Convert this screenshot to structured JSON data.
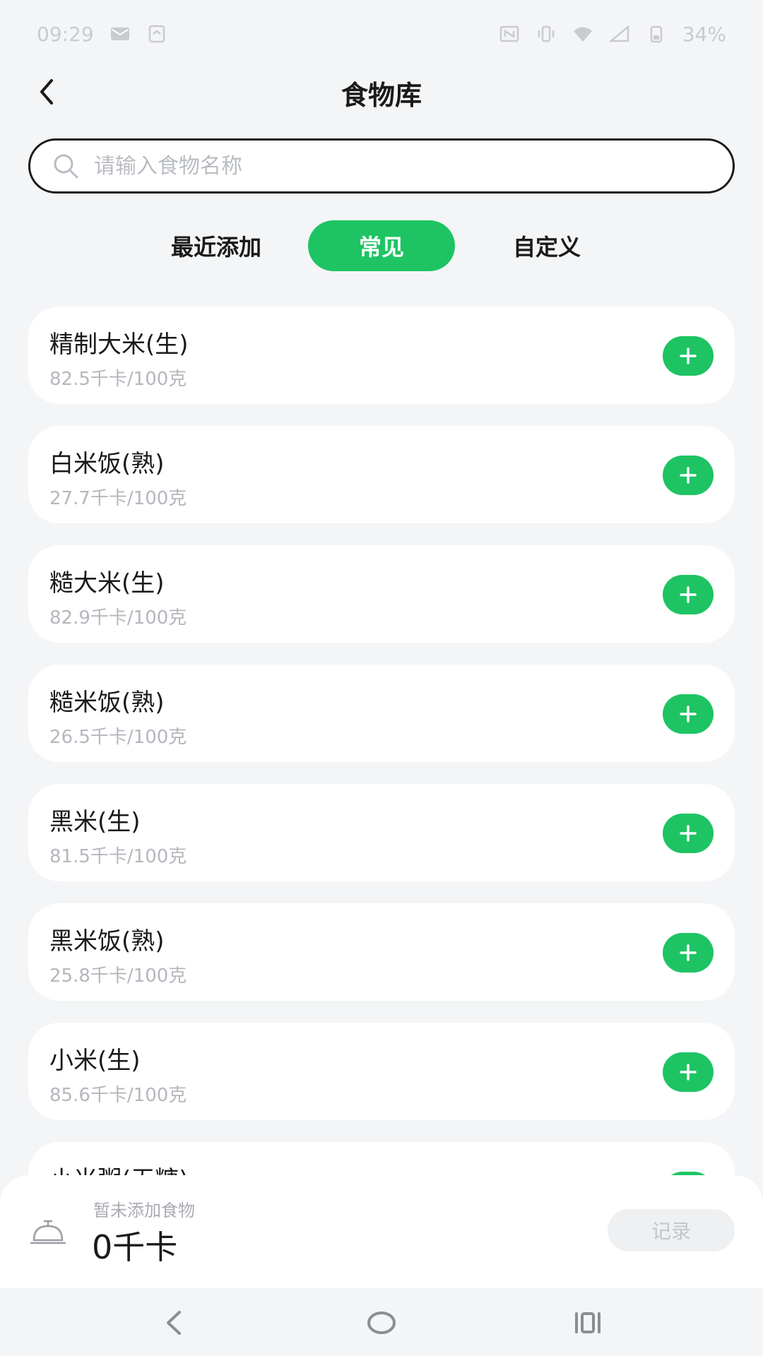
{
  "status_bar": {
    "time": "09:29",
    "battery": "34%"
  },
  "header": {
    "title": "食物库"
  },
  "search": {
    "placeholder": "请输入食物名称",
    "value": ""
  },
  "tabs": [
    {
      "label": "最近添加",
      "active": false
    },
    {
      "label": "常见",
      "active": true
    },
    {
      "label": "自定义",
      "active": false
    }
  ],
  "foods": [
    {
      "name": "精制大米(生)",
      "calories": "82.5千卡/100克"
    },
    {
      "name": "白米饭(熟)",
      "calories": "27.7千卡/100克"
    },
    {
      "name": "糙大米(生)",
      "calories": "82.9千卡/100克"
    },
    {
      "name": "糙米饭(熟)",
      "calories": "26.5千卡/100克"
    },
    {
      "name": "黑米(生)",
      "calories": "81.5千卡/100克"
    },
    {
      "name": "黑米饭(熟)",
      "calories": "25.8千卡/100克"
    },
    {
      "name": "小米(生)",
      "calories": "85.6千卡/100克"
    },
    {
      "name": "小米粥(无糖)",
      "calories": ""
    }
  ],
  "summary": {
    "hint": "暂未添加食物",
    "total": "0千卡",
    "record_label": "记录"
  },
  "colors": {
    "accent": "#1ec463",
    "background": "#f4f5f7"
  }
}
